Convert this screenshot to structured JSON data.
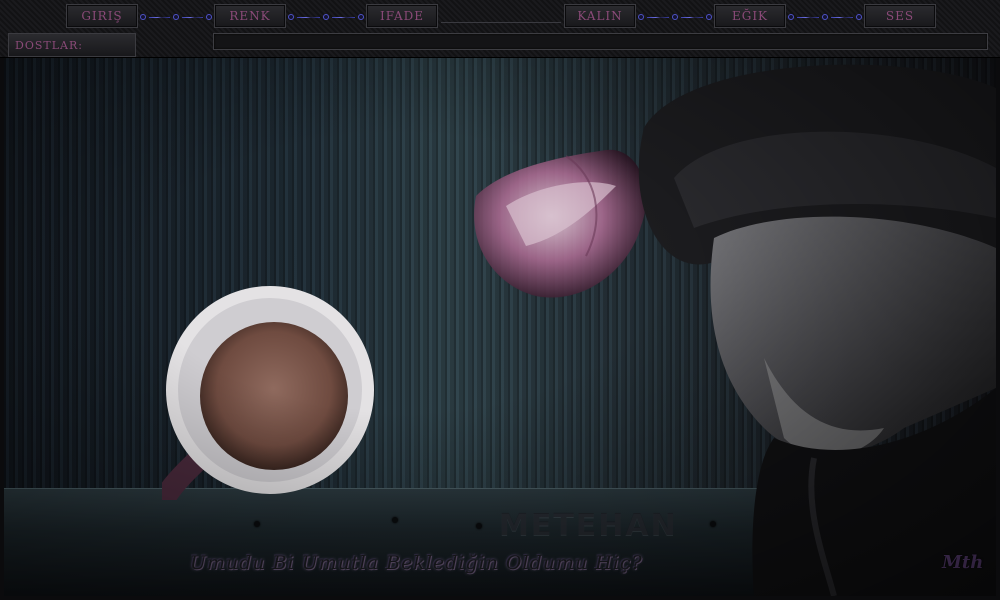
{
  "toolbar": {
    "giris": "GIRIŞ",
    "renk": "RENK",
    "ifade": "IFADE",
    "kalin": "KALIN",
    "egik": "EĞIK",
    "ses": "SES"
  },
  "dostlar": {
    "label": "DOSTLAR:",
    "value": ""
  },
  "scene": {
    "watermark": "METEHAN",
    "quote": "Umudu Bi Umutla Beklediğin Oldumu Hiç?",
    "signature": "Mth"
  },
  "colors": {
    "button_text": "#8a4a78",
    "chain": "#4f53c9",
    "background": "#0b0b0d"
  },
  "icons": [
    "chain-link-icon"
  ]
}
